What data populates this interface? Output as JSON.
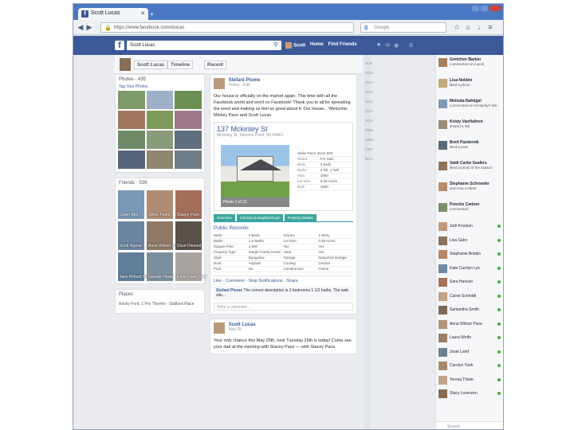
{
  "browser": {
    "tab_title": "Scott Lucas",
    "url": "https://www.facebook.com/slucas",
    "search_placeholder": "Google"
  },
  "fb": {
    "search_value": "Scott Lucas",
    "nav": [
      "Scott",
      "Home",
      "Find Friends"
    ]
  },
  "timeline": {
    "name": "Scott Lucas",
    "timeline_label": "Timeline",
    "recent_label": "Recent"
  },
  "left": {
    "photos_title": "Photos · 435",
    "tagged_label": "Tag Your Photos",
    "friends_title": "Friends · 539",
    "friends": [
      "Gavin Bird",
      "Joline Parks",
      "Stacey Pace",
      "Scott Ngoue",
      "Anna Wilson Tower",
      "Dave Dimond",
      "Jami Kirkum Stamper",
      "George Hasse",
      "Eddy Lowe, Gail"
    ],
    "places_title": "Places",
    "places_text": "Rocky Ford, 1 Pro Thermo · Stafford Place"
  },
  "center": {
    "post1": {
      "name": "Stefani Plume",
      "time": "Friday · Edit",
      "text": "Our house is officially on the market again. This time with all the Facebook world and word on Facebook! Thank you to all for spreading the word and making us feel so good about it. Our house... Welcome, Mickey Pace and Scott Lucas",
      "listing_addr": "137 Mckinley St",
      "listing_sub": "Mckinley St, Stevens Point, WI 54481",
      "caption": "Photo 1 of 31",
      "facts_title": "Seller Price: $124,900",
      "facts": [
        [
          "Status",
          "For Sale"
        ],
        [
          "Beds",
          "3 beds"
        ],
        [
          "Baths",
          "2 full, 1 half"
        ],
        [
          "Year",
          "1900"
        ],
        [
          "Lot Size",
          "0.38 Acres"
        ],
        [
          "Built",
          "1900"
        ]
      ],
      "tabs": [
        "Overview",
        "Schools & Neighborhood",
        "Property Details"
      ],
      "pubrec_title": "Public Records",
      "records": [
        "Beds",
        "3 Beds",
        "Stories",
        "1 Story",
        "Baths",
        "1.5 Baths",
        "Lot Size",
        "0.38 Acres",
        "Square Feet",
        "1,900",
        "Tax",
        "Yes",
        "Property Type",
        "Single Family Home",
        "Heat",
        "Yes",
        "Style",
        "Bungalow",
        "Garage",
        "Detached Garage",
        "Roof",
        "Asphalt",
        "Cooling",
        "Central",
        "Pool",
        "No",
        "Construction",
        "Frame"
      ],
      "actions": "Like · Comment · Stop Notifications · Share",
      "comment_name": "Stefani Plume",
      "comment_text": "The correct description is 3 bedrooms 1 1/2 baths. The web site...",
      "comment_placeholder": "Write a comment..."
    },
    "post2": {
      "name": "Scott Lucas",
      "time": "May 25",
      "text": "Your only chance this May 25th, next Tuesday 26th is today! Come see your dad at the meeting with Stacey Pace — with Stacey Pace."
    }
  },
  "months": [
    "Now",
    "2015",
    "2014",
    "2013",
    "2012",
    "2011",
    "2010",
    "2009",
    "2008",
    "2007",
    "Born"
  ],
  "chat": {
    "stories": [
      {
        "name": "Gretchen Barber",
        "story": "commented on a post",
        "color": "#a77e5a"
      },
      {
        "name": "Lisa Nolden",
        "story": "liked a photo",
        "color": "#c4a882"
      },
      {
        "name": "Melinda Nahtigal",
        "story": "commented on Kimberly's link",
        "color": "#7f9ab8"
      },
      {
        "name": "Kristy VanHaltren",
        "story": "shared a link",
        "color": "#9b8b74"
      },
      {
        "name": "Brett Pazdernik",
        "story": "liked a post",
        "color": "#5c6b7a"
      },
      {
        "name": "Valdi Carbe Seafers",
        "story": "liked a photo of the season",
        "color": "#8e7358"
      },
      {
        "name": "Stephanie Schroeder",
        "story": "and Amy Lindner",
        "color": "#b98d6e"
      },
      {
        "name": "Poncho Carbon",
        "story": "commented",
        "color": "#7c8f6a"
      }
    ],
    "online": [
      {
        "name": "Jodi Knutson",
        "color": "#c09a7a"
      },
      {
        "name": "Lisa Sabo",
        "color": "#8d735b"
      },
      {
        "name": "Stephanie Brisbin",
        "color": "#b58766"
      },
      {
        "name": "Kate Carolyn Lyn",
        "color": "#6e8aa8"
      },
      {
        "name": "Sara Hanson",
        "color": "#a86f57"
      },
      {
        "name": "Carrie Schmidt",
        "color": "#c5a285"
      },
      {
        "name": "Samantha Smith",
        "color": "#7d6a58"
      },
      {
        "name": "Anna Wilson Pace",
        "color": "#b3957b"
      },
      {
        "name": "Laura Wolfe",
        "color": "#9a7f66"
      },
      {
        "name": "Josie Laird",
        "color": "#6f7f92"
      },
      {
        "name": "Carolyn Yunk",
        "color": "#a98b6c"
      },
      {
        "name": "Teresa Thiele",
        "color": "#c2a48a"
      },
      {
        "name": "Stacy Lorenzen",
        "color": "#8a6c51"
      }
    ],
    "search_placeholder": "Search"
  }
}
